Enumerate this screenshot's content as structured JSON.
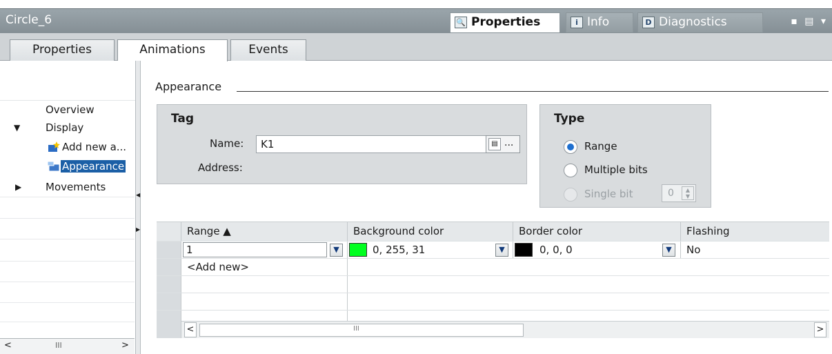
{
  "window": {
    "title": "Circle_6",
    "controls": "▪ ▤ ▾"
  },
  "inspector_tabs": [
    {
      "label": "Properties",
      "icon": "properties-icon",
      "glyph": "🔍"
    },
    {
      "label": "Info",
      "icon": "info-icon",
      "glyph": "i"
    },
    {
      "label": "Diagnostics",
      "icon": "diagnostics-icon",
      "glyph": "D"
    }
  ],
  "tabs": [
    "Properties",
    "Animations",
    "Events"
  ],
  "nav": {
    "overview": "Overview",
    "display": "Display",
    "add_new": "Add new a...",
    "appearance": "Appearance",
    "movements": "Movements",
    "scroll_mid": "III"
  },
  "section_title": "Appearance",
  "tag": {
    "title": "Tag",
    "name_label": "Name:",
    "name_value": "K1",
    "address_label": "Address:"
  },
  "type": {
    "title": "Type",
    "options": [
      "Range",
      "Multiple bits",
      "Single bit"
    ],
    "selected": "Range",
    "single_bit_value": "0"
  },
  "table": {
    "headers": [
      "Range ▲",
      "Background color",
      "Border color",
      "Flashing"
    ],
    "rows": [
      {
        "range": "1",
        "bg": "0, 255, 31",
        "bg_color": "#00ff1f",
        "border": "0, 0, 0",
        "border_color": "#000000",
        "flashing": "No"
      }
    ],
    "add_new": "<Add new>",
    "scroll_mid": "III"
  },
  "colors": {
    "selected_nav": "#1b5fa6",
    "radio_on": "#1e6fcf"
  }
}
